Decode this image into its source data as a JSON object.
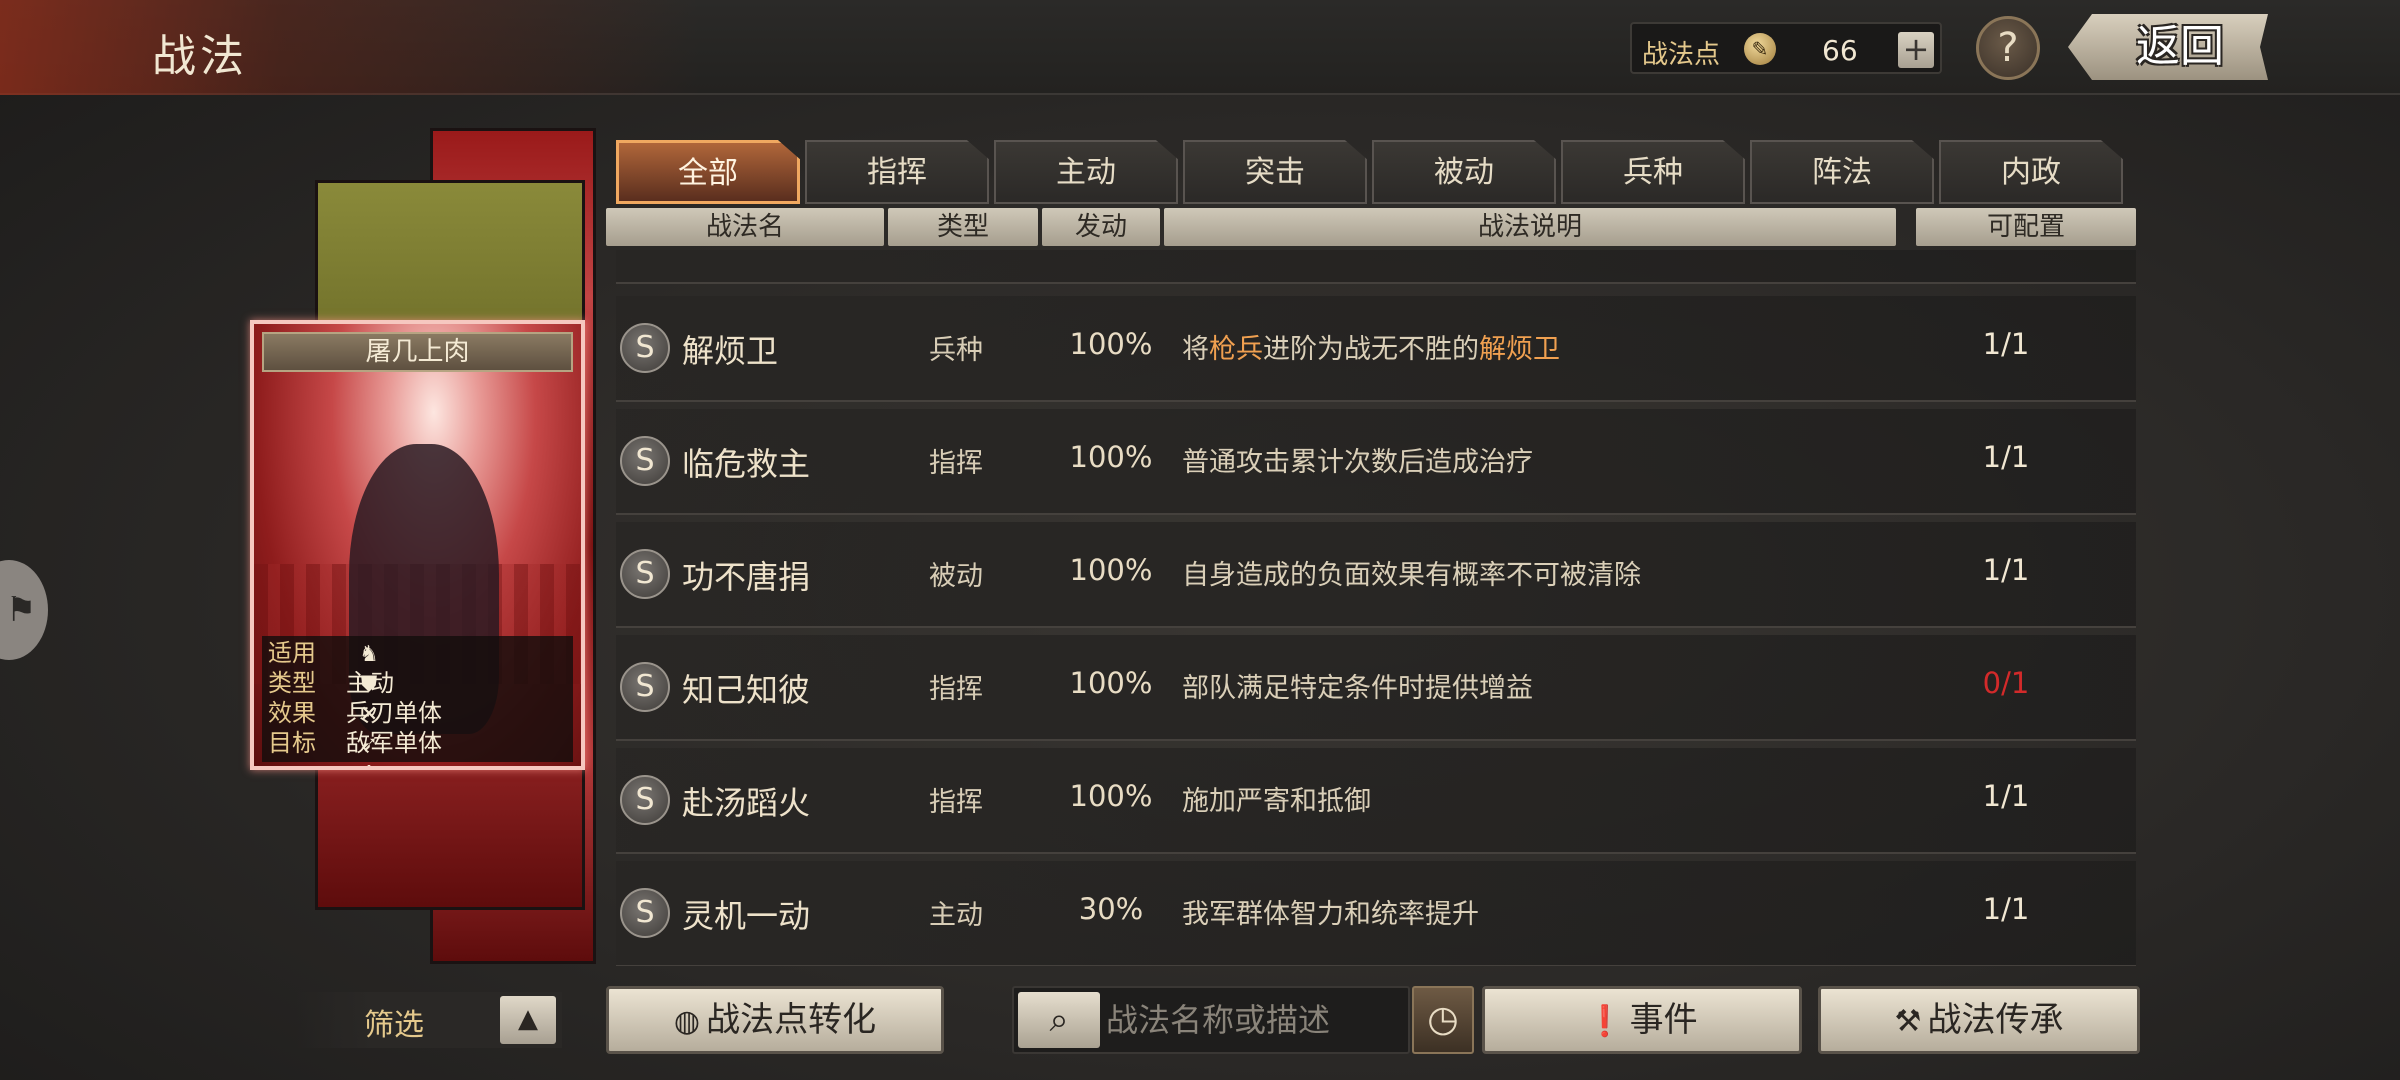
{
  "header": {
    "title": "战法",
    "points_label": "战法点",
    "points_value": "66",
    "plus_label": "+",
    "help_label": "?",
    "back_label": "返回"
  },
  "card": {
    "name": "屠几上肉",
    "rows": [
      {
        "key": "适用",
        "value": ""
      },
      {
        "key": "类型",
        "value": "主动"
      },
      {
        "key": "效果",
        "value": "兵刃单体"
      },
      {
        "key": "目标",
        "value": "敌军单体"
      }
    ],
    "troop_icons": [
      "cavalry-icon",
      "shield-icon",
      "bow-icon",
      "spear-icon",
      "siege-icon"
    ]
  },
  "tabs": [
    "全部",
    "指挥",
    "主动",
    "突击",
    "被动",
    "兵种",
    "阵法",
    "内政"
  ],
  "active_tab": "全部",
  "columns": [
    "战法名",
    "类型",
    "发动",
    "战法说明",
    "可配置"
  ],
  "skills": [
    {
      "badge": "S",
      "name": "解烦卫",
      "type": "兵种",
      "rate": "100%",
      "desc_a": "将",
      "desc_hl1": "枪兵",
      "desc_b": "进阶为战无不胜的",
      "desc_hl2": "解烦卫",
      "count": "1/1"
    },
    {
      "badge": "S",
      "name": "临危救主",
      "type": "指挥",
      "rate": "100%",
      "desc": "普通攻击累计次数后造成治疗",
      "count": "1/1"
    },
    {
      "badge": "S",
      "name": "功不唐捐",
      "type": "被动",
      "rate": "100%",
      "desc": "自身造成的负面效果有概率不可被清除",
      "count": "1/1"
    },
    {
      "badge": "S",
      "name": "知己知彼",
      "type": "指挥",
      "rate": "100%",
      "desc": "部队满足特定条件时提供增益",
      "count": "0/1"
    },
    {
      "badge": "S",
      "name": "赴汤蹈火",
      "type": "指挥",
      "rate": "100%",
      "desc": "施加严寄和抵御",
      "count": "1/1"
    },
    {
      "badge": "S",
      "name": "灵机一动",
      "type": "主动",
      "rate": "30%",
      "desc": "我军群体智力和统率提升",
      "count": "1/1"
    }
  ],
  "bottom": {
    "filter_label": "筛选",
    "filter_toggle": "▲",
    "convert_label": "战法点转化",
    "search_placeholder": "战法名称或描述",
    "events_label": "事件",
    "inherit_label": "战法传承"
  },
  "colors": {
    "accent": "#f0a860",
    "highlight_text": "#f0a050",
    "warning_count": "#d32a2a"
  }
}
